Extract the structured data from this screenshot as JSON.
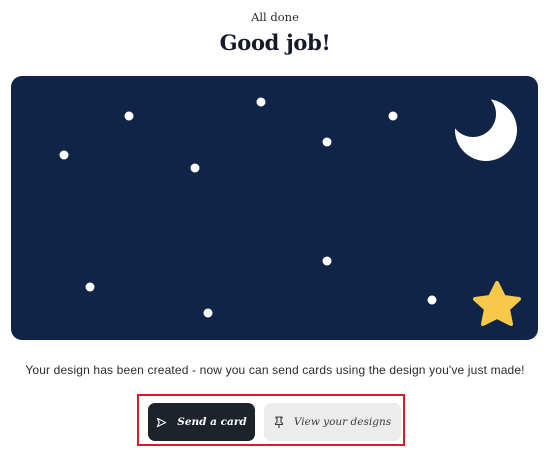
{
  "header": {
    "eyebrow": "All done",
    "title": "Good job!"
  },
  "card": {
    "background_color": "#0f2447",
    "moon_color": "#ffffff",
    "star_color": "#f7c948",
    "icons": [
      "moon-icon",
      "star-icon"
    ]
  },
  "message": "Your design has been created - now you can send cards using the design you've just made!",
  "actions": {
    "send_label": "Send a card",
    "send_icon": "send-icon",
    "view_label": "View your designs",
    "view_icon": "pin-icon",
    "highlight_color": "#d21f2a"
  }
}
